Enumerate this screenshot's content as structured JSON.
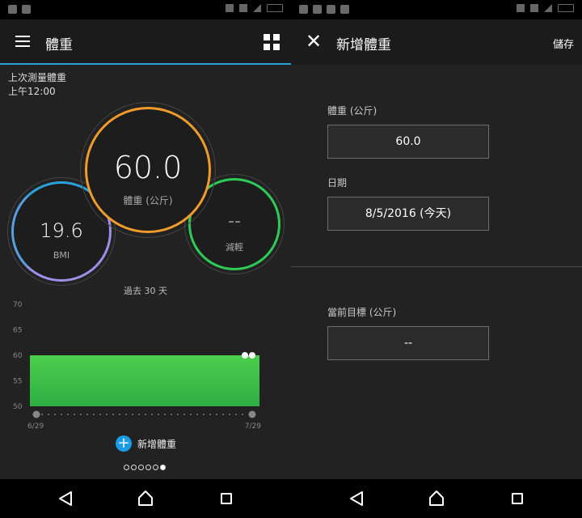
{
  "left": {
    "title": "體重",
    "last_measure_label": "上次測量體重",
    "last_measure_time": "上午12:00",
    "weight": {
      "value": "60.0",
      "label": "體重 (公斤)"
    },
    "bmi": {
      "value": "19.6",
      "label": "BMI"
    },
    "loss": {
      "value": "--",
      "label": "減輕"
    },
    "period_label": "過去 30 天",
    "add_label": "新增體重",
    "page_count": 6,
    "active_page": 6
  },
  "right": {
    "title": "新增體重",
    "save_label": "儲存",
    "weight_label": "體重 (公斤)",
    "weight_value": "60.0",
    "date_label": "日期",
    "date_value": "8/5/2016 (今天)",
    "goal_label": "當前目標 (公斤)",
    "goal_value": "--"
  },
  "chart_data": {
    "type": "area",
    "x": [
      "6/29",
      "7/29"
    ],
    "x_tick_labels": [
      "6/29",
      "7/29"
    ],
    "y_ticks": [
      70,
      65,
      60,
      55,
      50
    ],
    "ylim": [
      50,
      70
    ],
    "values": [
      60,
      60
    ],
    "grid": false,
    "colors": {
      "fill_top": "#4cce4c",
      "fill_bottom": "#2fae44",
      "marker": "#ffffff",
      "axis_dot": "#777777"
    }
  },
  "colors": {
    "accent": "#2aa3dc",
    "weight_ring": "#f19b2c",
    "loss_ring": "#2ecc57",
    "bmi_ring": "#9b8fe6",
    "add_button": "#1a9be8"
  },
  "icons": {
    "menu": "hamburger-icon",
    "grid": "grid-icon",
    "close": "close-icon",
    "add": "plus-icon",
    "back": "back-triangle-icon",
    "home": "home-icon",
    "recent": "recent-square-icon"
  }
}
